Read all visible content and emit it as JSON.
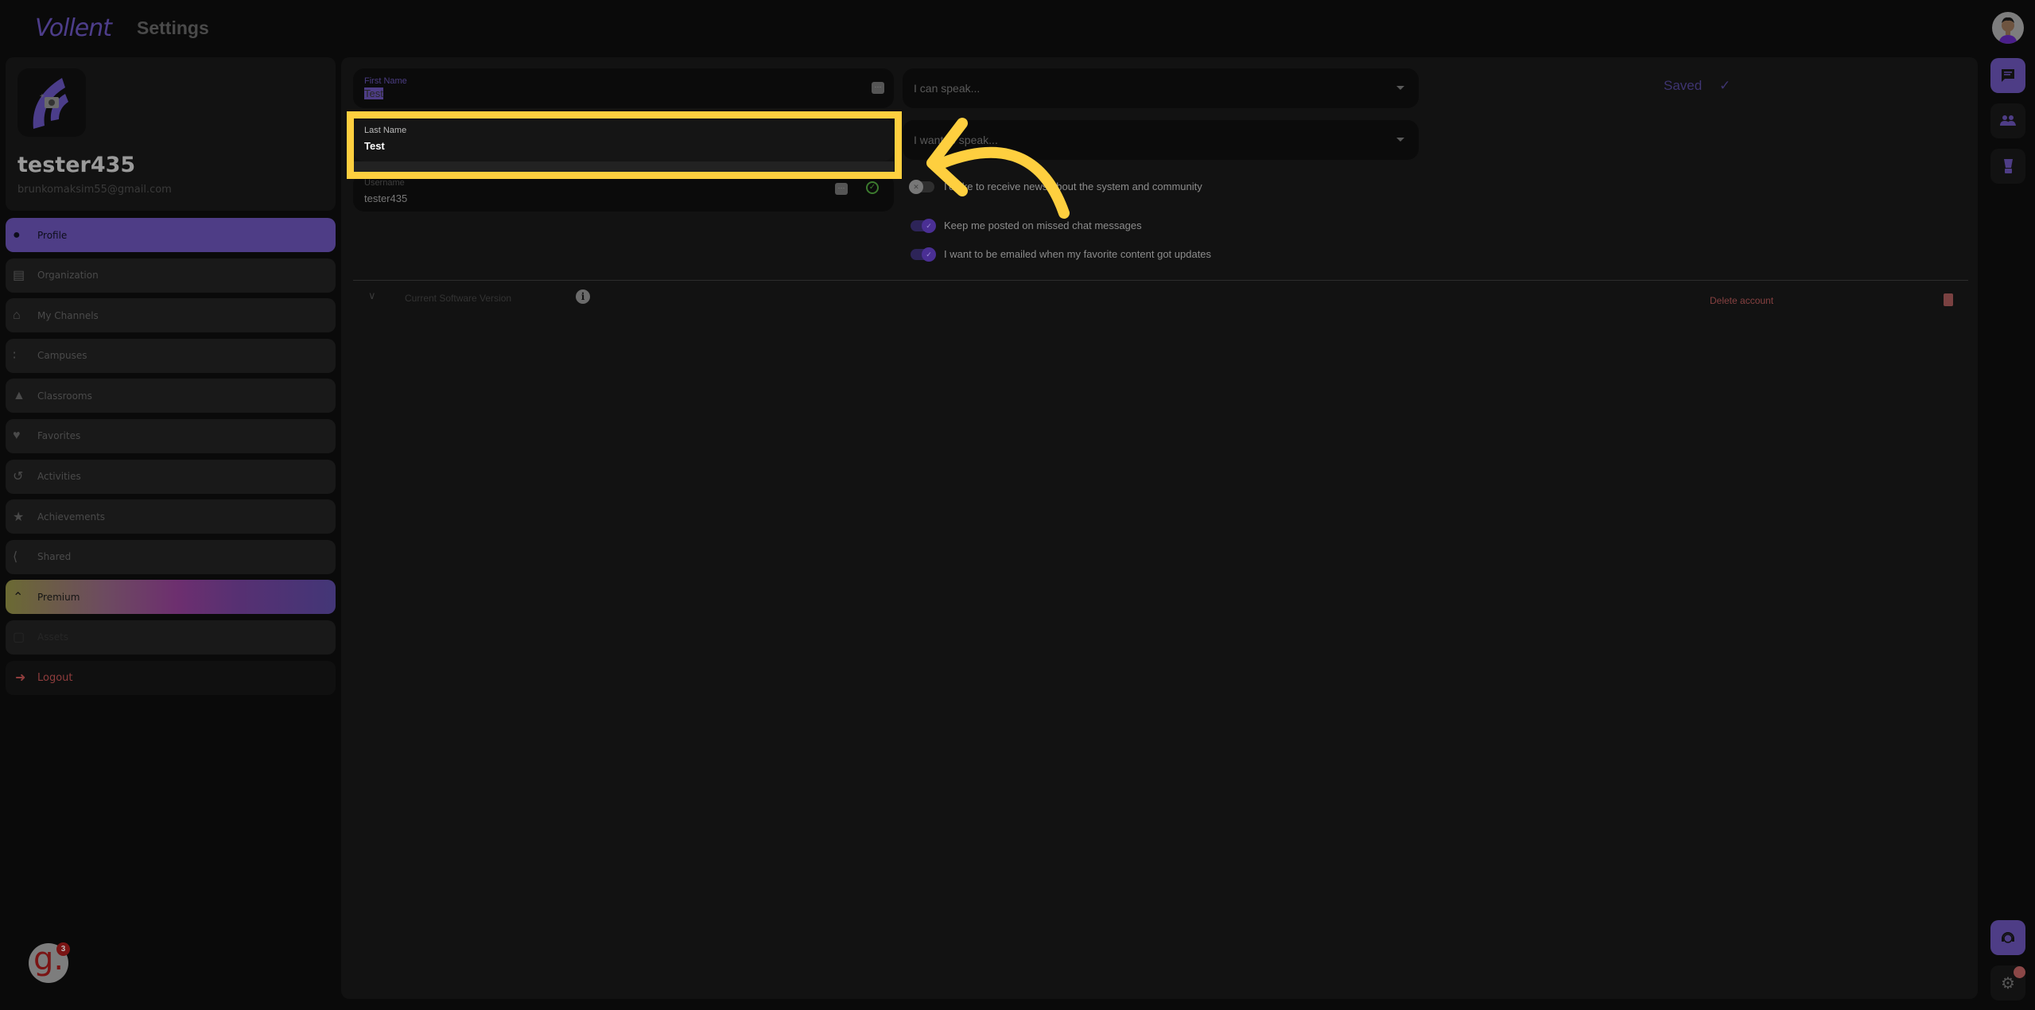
{
  "header": {
    "logo_text": "Vollent",
    "title": "Settings"
  },
  "profile": {
    "username": "tester435",
    "email": "brunkomaksim55@gmail.com"
  },
  "sidebar": {
    "items": [
      {
        "label": "Profile",
        "icon": "user-circle-icon",
        "state": "active"
      },
      {
        "label": "Organization",
        "icon": "building-icon",
        "state": "normal"
      },
      {
        "label": "My Channels",
        "icon": "home-icon",
        "state": "normal"
      },
      {
        "label": "Campuses",
        "icon": "group-icon",
        "state": "normal"
      },
      {
        "label": "Classrooms",
        "icon": "graduation-cap-icon",
        "state": "normal"
      },
      {
        "label": "Favorites",
        "icon": "heart-icon",
        "state": "normal"
      },
      {
        "label": "Activities",
        "icon": "history-icon",
        "state": "normal"
      },
      {
        "label": "Achievements",
        "icon": "trophy-icon",
        "state": "normal"
      },
      {
        "label": "Shared",
        "icon": "share-icon",
        "state": "normal"
      },
      {
        "label": "Premium",
        "icon": "double-chevron-up-icon",
        "state": "premium"
      },
      {
        "label": "Assets",
        "icon": "square-icon",
        "state": "disabled"
      },
      {
        "label": "Logout",
        "icon": "logout-icon",
        "state": "logout"
      }
    ]
  },
  "form": {
    "first_name": {
      "label": "First Name",
      "value": "Test"
    },
    "last_name": {
      "label": "Last Name",
      "value": "Test"
    },
    "username": {
      "label": "Username",
      "value": "tester435"
    },
    "can_speak": {
      "placeholder": "I can speak..."
    },
    "want_speak": {
      "placeholder": "I want to speak..."
    }
  },
  "toggles": [
    {
      "label": "I'd like to receive news about the system and community",
      "on": false
    },
    {
      "label": "Keep me posted on missed chat messages",
      "on": true
    },
    {
      "label": "I want to be emailed when my favorite content got updates",
      "on": true
    }
  ],
  "status": {
    "saved_label": "Saved"
  },
  "footer": {
    "version_label": "Current Software Version",
    "delete_label": "Delete account"
  },
  "widget": {
    "letter": "g.",
    "badge_count": "3"
  },
  "colors": {
    "accent": "#4e3d86",
    "highlight": "#fecf3f",
    "danger": "#864141"
  }
}
